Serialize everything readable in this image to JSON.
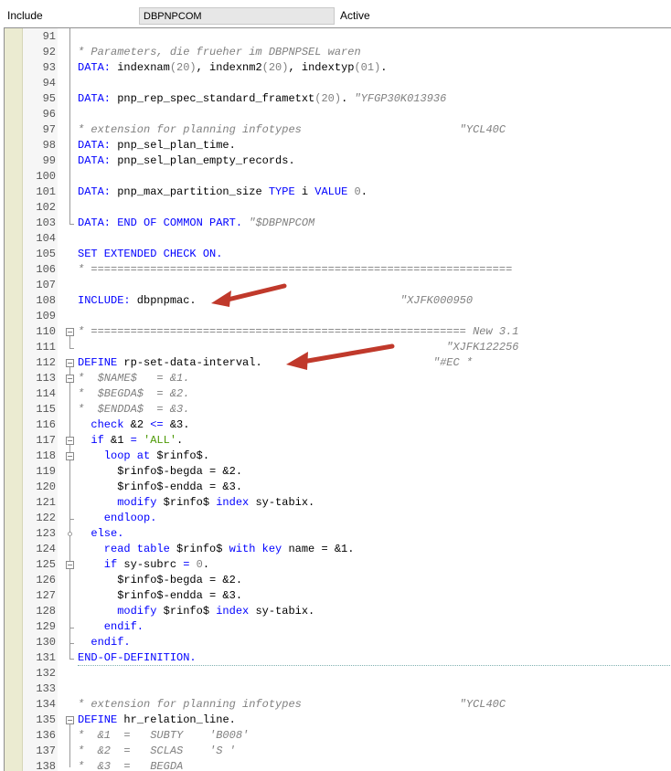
{
  "header": {
    "label": "Include",
    "program_name": "DBPNPCOM",
    "status": "Active"
  },
  "lines": [
    {
      "n": "91",
      "parts": []
    },
    {
      "n": "92",
      "parts": [
        {
          "t": "* Parameters, die frueher im DBPNPSEL waren",
          "c": "cm"
        }
      ]
    },
    {
      "n": "93",
      "parts": [
        {
          "t": "DATA:",
          "c": "kw"
        },
        {
          "t": " indexnam",
          "c": ""
        },
        {
          "t": "(20)",
          "c": "nm"
        },
        {
          "t": ", indexnm2",
          "c": ""
        },
        {
          "t": "(20)",
          "c": "nm"
        },
        {
          "t": ", indextyp",
          "c": ""
        },
        {
          "t": "(01)",
          "c": "nm"
        },
        {
          "t": ".",
          "c": ""
        }
      ]
    },
    {
      "n": "94",
      "parts": []
    },
    {
      "n": "95",
      "parts": [
        {
          "t": "DATA:",
          "c": "kw"
        },
        {
          "t": " pnp_rep_spec_standard_frametxt",
          "c": ""
        },
        {
          "t": "(20)",
          "c": "nm"
        },
        {
          "t": ". ",
          "c": ""
        },
        {
          "t": "\"YFGP30K013936",
          "c": "cm"
        }
      ]
    },
    {
      "n": "96",
      "parts": []
    },
    {
      "n": "97",
      "parts": [
        {
          "t": "* extension for planning infotypes                        \"YCL40C",
          "c": "cm"
        }
      ]
    },
    {
      "n": "98",
      "parts": [
        {
          "t": "DATA:",
          "c": "kw"
        },
        {
          "t": " pnp_sel_plan_time.",
          "c": ""
        }
      ]
    },
    {
      "n": "99",
      "parts": [
        {
          "t": "DATA:",
          "c": "kw"
        },
        {
          "t": " pnp_sel_plan_empty_records.",
          "c": ""
        }
      ]
    },
    {
      "n": "100",
      "parts": []
    },
    {
      "n": "101",
      "parts": [
        {
          "t": "DATA:",
          "c": "kw"
        },
        {
          "t": " pnp_max_partition_size ",
          "c": ""
        },
        {
          "t": "TYPE",
          "c": "kw"
        },
        {
          "t": " i ",
          "c": ""
        },
        {
          "t": "VALUE",
          "c": "kw"
        },
        {
          "t": " 0",
          "c": "nm"
        },
        {
          "t": ".",
          "c": ""
        }
      ]
    },
    {
      "n": "102",
      "parts": []
    },
    {
      "n": "103",
      "parts": [
        {
          "t": "DATA:",
          "c": "kw"
        },
        {
          "t": " ",
          "c": ""
        },
        {
          "t": "END OF COMMON PART.",
          "c": "kw"
        },
        {
          "t": " ",
          "c": ""
        },
        {
          "t": "\"$DBPNPCOM",
          "c": "cm"
        }
      ]
    },
    {
      "n": "104",
      "parts": []
    },
    {
      "n": "105",
      "parts": [
        {
          "t": "SET EXTENDED CHECK ON.",
          "c": "kw"
        }
      ]
    },
    {
      "n": "106",
      "parts": [
        {
          "t": "* ================================================================",
          "c": "cm"
        }
      ]
    },
    {
      "n": "107",
      "parts": []
    },
    {
      "n": "108",
      "parts": [
        {
          "t": "INCLUDE:",
          "c": "kw"
        },
        {
          "t": " dbpnpmac.",
          "c": ""
        },
        {
          "t": "                               \"XJFK000950",
          "c": "cm"
        }
      ]
    },
    {
      "n": "109",
      "parts": []
    },
    {
      "n": "110",
      "parts": [
        {
          "t": "* ========================================================= New 3.1",
          "c": "cm"
        }
      ]
    },
    {
      "n": "111",
      "parts": [
        {
          "t": "                                                        \"XJFK122256",
          "c": "cm"
        }
      ]
    },
    {
      "n": "112",
      "parts": [
        {
          "t": "DEFINE",
          "c": "kw"
        },
        {
          "t": " rp-set-data-interval.",
          "c": ""
        },
        {
          "t": "                          \"#EC *",
          "c": "cm"
        }
      ]
    },
    {
      "n": "113",
      "parts": [
        {
          "t": "*  $NAME$   = &1.",
          "c": "cm"
        }
      ]
    },
    {
      "n": "114",
      "parts": [
        {
          "t": "*  $BEGDA$  = &2.",
          "c": "cm"
        }
      ]
    },
    {
      "n": "115",
      "parts": [
        {
          "t": "*  $ENDDA$  = &3.",
          "c": "cm"
        }
      ]
    },
    {
      "n": "116",
      "parts": [
        {
          "t": "  check",
          "c": "kw"
        },
        {
          "t": " &2 ",
          "c": ""
        },
        {
          "t": "<=",
          "c": "kw"
        },
        {
          "t": " &3.",
          "c": ""
        }
      ]
    },
    {
      "n": "117",
      "parts": [
        {
          "t": "  if",
          "c": "kw"
        },
        {
          "t": " &1 ",
          "c": ""
        },
        {
          "t": "=",
          "c": "kw"
        },
        {
          "t": " ",
          "c": ""
        },
        {
          "t": "'ALL'",
          "c": "st"
        },
        {
          "t": ".",
          "c": ""
        }
      ]
    },
    {
      "n": "118",
      "parts": [
        {
          "t": "    loop at",
          "c": "kw"
        },
        {
          "t": " $rinfo$.",
          "c": ""
        }
      ]
    },
    {
      "n": "119",
      "parts": [
        {
          "t": "      $rinfo$-begda = &2.",
          "c": ""
        }
      ]
    },
    {
      "n": "120",
      "parts": [
        {
          "t": "      $rinfo$-endda = &3.",
          "c": ""
        }
      ]
    },
    {
      "n": "121",
      "parts": [
        {
          "t": "      modify",
          "c": "kw"
        },
        {
          "t": " $rinfo$ ",
          "c": ""
        },
        {
          "t": "index",
          "c": "kw"
        },
        {
          "t": " sy-tabix.",
          "c": ""
        }
      ]
    },
    {
      "n": "122",
      "parts": [
        {
          "t": "    endloop.",
          "c": "kw"
        }
      ]
    },
    {
      "n": "123",
      "parts": [
        {
          "t": "  else.",
          "c": "kw"
        }
      ]
    },
    {
      "n": "124",
      "parts": [
        {
          "t": "    read table",
          "c": "kw"
        },
        {
          "t": " $rinfo$ ",
          "c": ""
        },
        {
          "t": "with key",
          "c": "kw"
        },
        {
          "t": " name = &1.",
          "c": ""
        }
      ]
    },
    {
      "n": "125",
      "parts": [
        {
          "t": "    if",
          "c": "kw"
        },
        {
          "t": " sy-subrc ",
          "c": ""
        },
        {
          "t": "=",
          "c": "kw"
        },
        {
          "t": " 0",
          "c": "nm"
        },
        {
          "t": ".",
          "c": ""
        }
      ]
    },
    {
      "n": "126",
      "parts": [
        {
          "t": "      $rinfo$-begda = &2.",
          "c": ""
        }
      ]
    },
    {
      "n": "127",
      "parts": [
        {
          "t": "      $rinfo$-endda = &3.",
          "c": ""
        }
      ]
    },
    {
      "n": "128",
      "parts": [
        {
          "t": "      modify",
          "c": "kw"
        },
        {
          "t": " $rinfo$ ",
          "c": ""
        },
        {
          "t": "index",
          "c": "kw"
        },
        {
          "t": " sy-tabix.",
          "c": ""
        }
      ]
    },
    {
      "n": "129",
      "parts": [
        {
          "t": "    endif.",
          "c": "kw"
        }
      ]
    },
    {
      "n": "130",
      "parts": [
        {
          "t": "  endif.",
          "c": "kw"
        }
      ]
    },
    {
      "n": "131",
      "parts": [
        {
          "t": "END-OF-DEFINITION.",
          "c": "kw"
        }
      ]
    },
    {
      "n": "132",
      "parts": []
    },
    {
      "n": "133",
      "parts": []
    },
    {
      "n": "134",
      "parts": [
        {
          "t": "* extension for planning infotypes                        \"YCL40C",
          "c": "cm"
        }
      ]
    },
    {
      "n": "135",
      "parts": [
        {
          "t": "DEFINE",
          "c": "kw"
        },
        {
          "t": " hr_relation_line.",
          "c": ""
        }
      ]
    },
    {
      "n": "136",
      "parts": [
        {
          "t": "*  &1  =   SUBTY    'B008'",
          "c": "cm"
        }
      ]
    },
    {
      "n": "137",
      "parts": [
        {
          "t": "*  &2  =   SCLAS    'S '",
          "c": "cm"
        }
      ]
    },
    {
      "n": "138",
      "parts": [
        {
          "t": "*  &3  =   BEGDA",
          "c": "cm"
        }
      ]
    }
  ],
  "colors": {
    "keyword": "#0000ff",
    "comment": "#808080",
    "string": "#4e9a06",
    "arrow": "#c0392b",
    "bookmark_gutter": "#ebebd1"
  },
  "icons": {
    "fold_expanded": "minus-box-icon",
    "annotation": "red-arrow-icon"
  }
}
